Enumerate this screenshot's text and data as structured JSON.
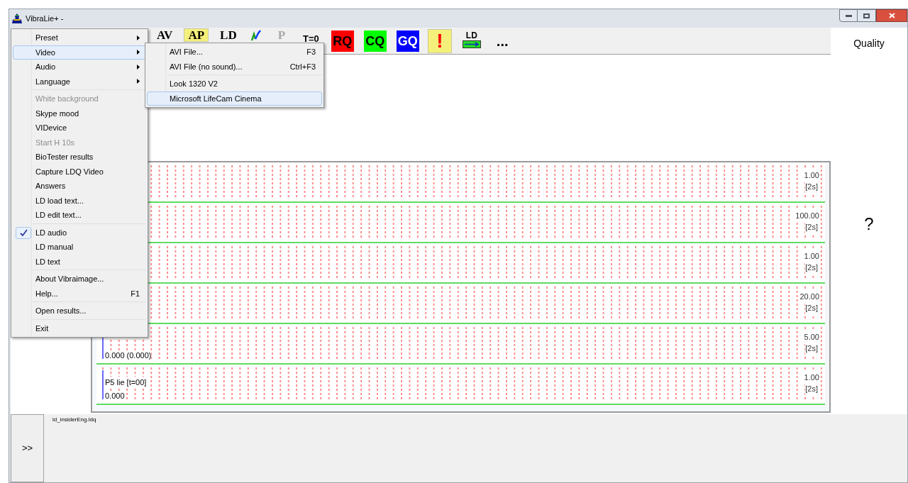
{
  "window": {
    "title": "VibraLie+ -"
  },
  "toolbar": [
    {
      "kind": "serif",
      "label": "AV",
      "selected": false
    },
    {
      "kind": "serif",
      "label": "AP",
      "selected": true
    },
    {
      "kind": "serif",
      "label": "LD",
      "selected": false
    },
    {
      "kind": "chart",
      "selected": false
    },
    {
      "kind": "disabled",
      "label": "P",
      "selected": false
    },
    {
      "kind": "small",
      "label": "T=0",
      "selected": false
    },
    {
      "kind": "color",
      "label": "RQ",
      "color": "#ff0000",
      "selected": false
    },
    {
      "kind": "color",
      "label": "CQ",
      "color": "#00ff00",
      "selected": false
    },
    {
      "kind": "color",
      "label": "GQ",
      "color": "#0000ff",
      "selected": false
    },
    {
      "kind": "alert",
      "label": "!",
      "selected": true
    },
    {
      "kind": "arrow",
      "label": "LD",
      "selected": false
    },
    {
      "kind": "more",
      "label": "...",
      "selected": false
    }
  ],
  "menu": [
    {
      "kind": "item",
      "label": "Preset",
      "submenu": true,
      "selected": false
    },
    {
      "kind": "item",
      "label": "Video",
      "submenu": true,
      "selected": true
    },
    {
      "kind": "item",
      "label": "Audio",
      "submenu": true,
      "selected": false
    },
    {
      "kind": "item",
      "label": "Language",
      "submenu": true,
      "selected": false
    },
    {
      "kind": "separator"
    },
    {
      "kind": "item",
      "label": "White background",
      "disabled": true,
      "selected": false
    },
    {
      "kind": "item",
      "label": "Skype mood",
      "selected": false
    },
    {
      "kind": "item",
      "label": "VIDevice",
      "selected": false
    },
    {
      "kind": "item",
      "label": "Start H 10s",
      "disabled": true,
      "selected": false
    },
    {
      "kind": "item",
      "label": "BioTester results",
      "selected": false
    },
    {
      "kind": "item",
      "label": "Capture LDQ Video",
      "selected": false
    },
    {
      "kind": "item",
      "label": "Answers",
      "selected": false
    },
    {
      "kind": "item",
      "label": "LD load text...",
      "selected": false
    },
    {
      "kind": "item",
      "label": "LD edit text...",
      "selected": false
    },
    {
      "kind": "separator"
    },
    {
      "kind": "item",
      "label": "LD audio",
      "checked": true,
      "selected": false
    },
    {
      "kind": "item",
      "label": "LD manual",
      "checked": false,
      "selected": false
    },
    {
      "kind": "item",
      "label": "LD text",
      "checked": false,
      "selected": false
    },
    {
      "kind": "separator"
    },
    {
      "kind": "item",
      "label": "About Vibraimage...",
      "selected": false
    },
    {
      "kind": "item",
      "label": "Help...",
      "shortcut": "F1",
      "selected": false
    },
    {
      "kind": "separator"
    },
    {
      "kind": "item",
      "label": "Open results...",
      "selected": false
    },
    {
      "kind": "separator"
    },
    {
      "kind": "item",
      "label": "Exit",
      "selected": false
    }
  ],
  "submenu": [
    {
      "kind": "item",
      "label": "AVI File...",
      "shortcut": "F3",
      "selected": false
    },
    {
      "kind": "item",
      "label": "AVI File (no sound)...",
      "shortcut": "Ctrl+F3",
      "selected": false
    },
    {
      "kind": "separator"
    },
    {
      "kind": "item",
      "label": "Look 1320 V2",
      "selected": false
    },
    {
      "kind": "item",
      "label": "Microsoft LifeCam Cinema",
      "selected": true
    }
  ],
  "charts": [
    {
      "max": "1.00",
      "span": "[2s]"
    },
    {
      "max": "100.00",
      "span": "[2s]"
    },
    {
      "max": "1.00",
      "span": "[2s]"
    },
    {
      "max": "20.00",
      "span": "[2s]"
    },
    {
      "value": "0.000 (0.000)",
      "max": "5.00",
      "span": "[2s]"
    },
    {
      "name": "P5 lie [t=00]",
      "value": "0.000",
      "max": "1.00",
      "span": "[2s]"
    }
  ],
  "right_panel": {
    "title": "Quality",
    "value": "?"
  },
  "bottom": {
    "button": ">>",
    "file": "ld_insiderEng.ldq"
  }
}
